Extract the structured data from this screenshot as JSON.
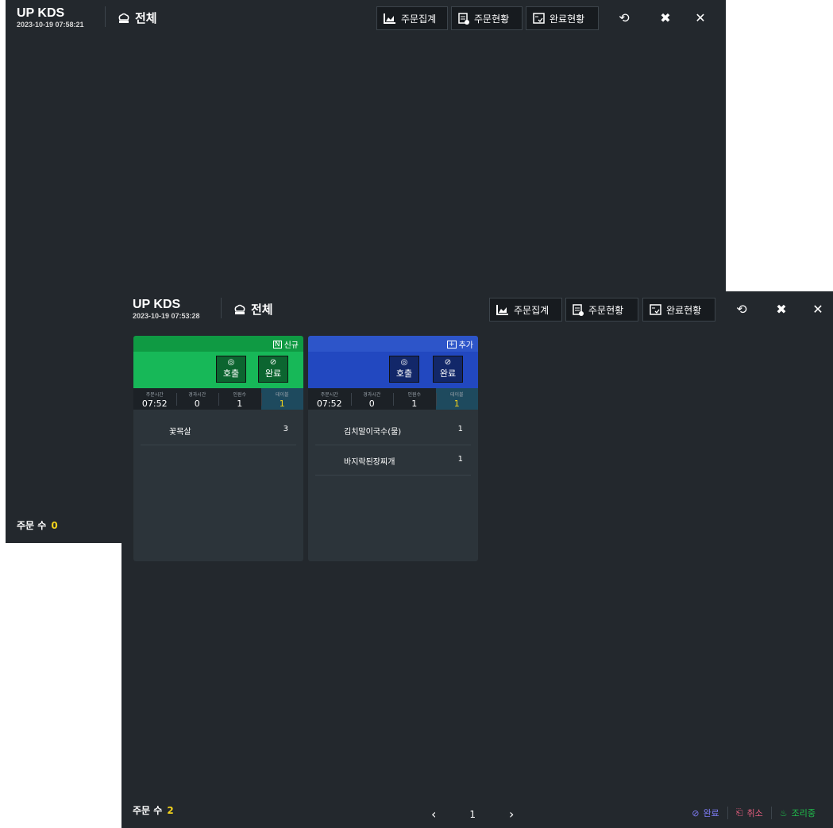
{
  "back": {
    "title": "UP KDS",
    "datetime": "2023-10-19 07:58:21",
    "all_label": "전체",
    "buttons": {
      "summary": "주문집계",
      "status": "주문현황",
      "done_status": "완료현황"
    },
    "order_count_label": "주문 수",
    "order_count": "0"
  },
  "front": {
    "title": "UP KDS",
    "datetime": "2023-10-19 07:53:28",
    "all_label": "전체",
    "buttons": {
      "summary": "주문집계",
      "status": "주문현황",
      "done_status": "완료현황"
    },
    "order_count_label": "주문 수",
    "order_count": "2",
    "orders": [
      {
        "tag": "신규",
        "tag_icon": "new-badge-icon",
        "color": "#17b858",
        "band_color": "#0f9a43",
        "call_label": "호출",
        "done_label": "완료",
        "info_labels": [
          "주문시간",
          "경과시간",
          "인원수",
          "테이블"
        ],
        "order_time": "07:52",
        "elapsed": "0",
        "people": "1",
        "table": "1",
        "items": [
          {
            "name": "꽃목살",
            "qty": "3"
          }
        ]
      },
      {
        "tag": "추가",
        "tag_icon": "add-icon",
        "color": "#2248c0",
        "band_color": "#2d55c9",
        "call_label": "호출",
        "done_label": "완료",
        "info_labels": [
          "주문시간",
          "경과시간",
          "인원수",
          "테이블"
        ],
        "order_time": "07:52",
        "elapsed": "0",
        "people": "1",
        "table": "1",
        "items": [
          {
            "name": "김치말이국수(물)",
            "qty": "1"
          },
          {
            "name": "바지락된장찌개",
            "qty": "1"
          }
        ]
      }
    ],
    "pager": {
      "page": "1"
    },
    "legend": [
      {
        "label": "완료",
        "color": "#7e7cf5",
        "icon": "check-circle-icon"
      },
      {
        "label": "취소",
        "color": "#e35d7d",
        "icon": "cancel-doc-icon"
      },
      {
        "label": "조리중",
        "color": "#1fbf4b",
        "icon": "cooking-icon"
      }
    ]
  }
}
